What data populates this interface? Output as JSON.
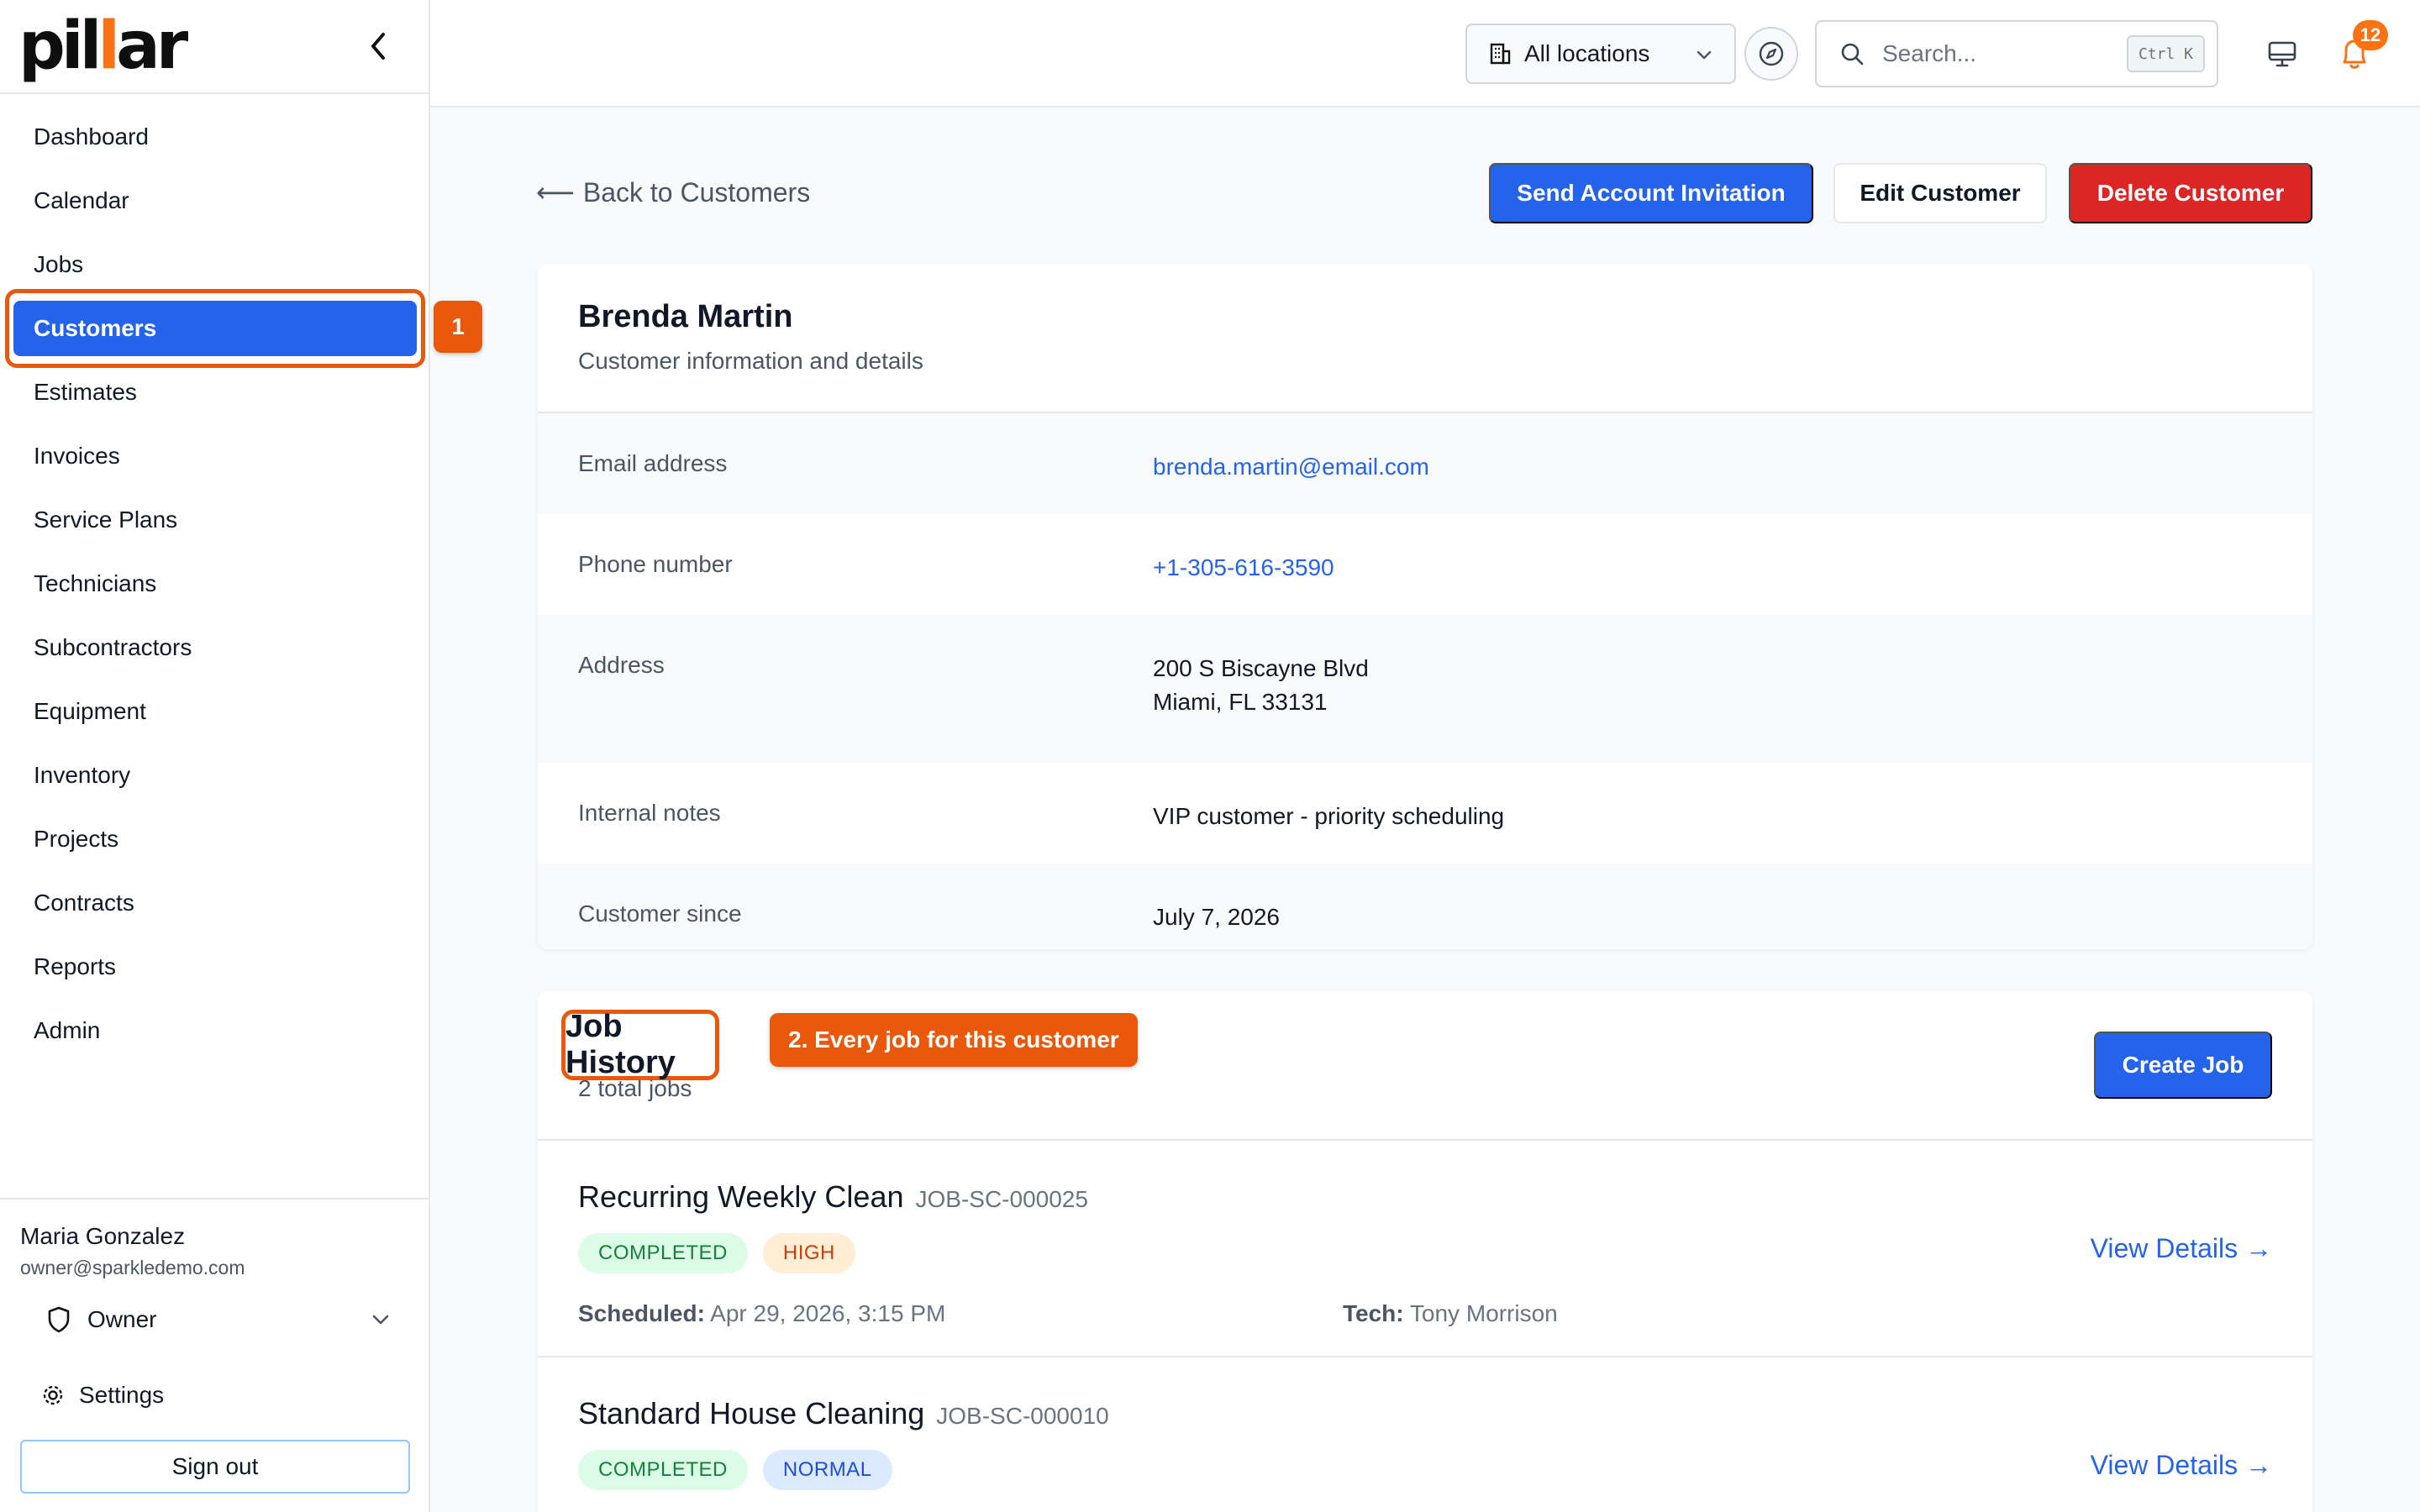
{
  "brand": {
    "logo_pre": "pil",
    "logo_bar": "l",
    "logo_post": "ar"
  },
  "sidebar": {
    "items": [
      {
        "label": "Dashboard"
      },
      {
        "label": "Calendar"
      },
      {
        "label": "Jobs"
      },
      {
        "label": "Customers",
        "active": true
      },
      {
        "label": "Estimates"
      },
      {
        "label": "Invoices"
      },
      {
        "label": "Service Plans"
      },
      {
        "label": "Technicians"
      },
      {
        "label": "Subcontractors"
      },
      {
        "label": "Equipment"
      },
      {
        "label": "Inventory"
      },
      {
        "label": "Projects"
      },
      {
        "label": "Contracts"
      },
      {
        "label": "Reports"
      },
      {
        "label": "Admin"
      }
    ],
    "step_badge": "1",
    "user": {
      "name": "Maria Gonzalez",
      "email": "owner@sparkledemo.com"
    },
    "role": "Owner",
    "settings_label": "Settings",
    "signout_label": "Sign out"
  },
  "header": {
    "location": "All locations",
    "search_placeholder": "Search...",
    "search_shortcut": "Ctrl K",
    "notification_count": "12"
  },
  "actions": {
    "back": "Back to Customers",
    "send_invite": "Send Account Invitation",
    "edit": "Edit Customer",
    "delete": "Delete Customer"
  },
  "customer": {
    "name": "Brenda Martin",
    "subtitle": "Customer information and details",
    "fields": [
      {
        "label": "Email address",
        "value": "brenda.martin@email.com"
      },
      {
        "label": "Phone number",
        "value": "+1-305-616-3590"
      },
      {
        "label": "Address",
        "line1": "200 S Biscayne Blvd",
        "line2": "Miami, FL 33131"
      },
      {
        "label": "Internal notes",
        "value": "VIP customer - priority scheduling"
      },
      {
        "label": "Customer since",
        "value": "July 7, 2026"
      }
    ]
  },
  "job_history": {
    "title": "Job History",
    "count": "2 total jobs",
    "callout": "2. Every job for this customer",
    "create_label": "Create Job",
    "jobs": [
      {
        "title": "Recurring Weekly Clean",
        "id": "JOB-SC-000025",
        "status": "COMPLETED",
        "priority": "HIGH",
        "scheduled_label": "Scheduled:",
        "scheduled": "Apr 29, 2026, 3:15 PM",
        "tech_label": "Tech:",
        "tech": "Tony Morrison",
        "view": "View Details →"
      },
      {
        "title": "Standard House Cleaning",
        "id": "JOB-SC-000010",
        "status": "COMPLETED",
        "priority": "NORMAL",
        "view": "View Details →"
      }
    ]
  },
  "colors": {
    "primary": "#2563eb",
    "danger": "#dc2626",
    "accent": "#ea580c"
  }
}
